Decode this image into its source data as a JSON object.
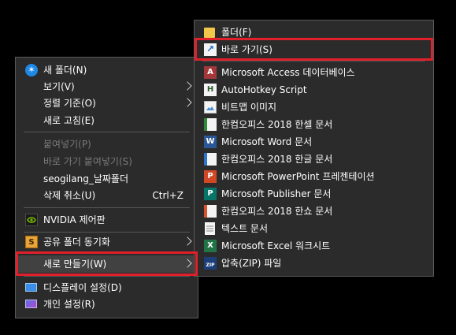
{
  "context_menu": {
    "items": [
      {
        "label": "새 폴더(N)"
      },
      {
        "label": "보기(V)"
      },
      {
        "label": "정렬 기준(O)"
      },
      {
        "label": "새로 고침(E)"
      },
      {
        "label": "붙여넣기(P)"
      },
      {
        "label": "바로 가기 붙여넣기(S)"
      },
      {
        "label": "seogilang_날짜폴더"
      },
      {
        "label": "삭제 취소(U)",
        "shortcut": "Ctrl+Z"
      },
      {
        "label": "NVIDIA 제어판"
      },
      {
        "label": "공유 폴더 동기화"
      },
      {
        "label": "새로 만들기(W)"
      },
      {
        "label": "디스플레이 설정(D)"
      },
      {
        "label": "개인 설정(R)"
      }
    ]
  },
  "new_submenu": {
    "items": [
      {
        "label": "폴더(F)"
      },
      {
        "label": "바로 가기(S)"
      },
      {
        "label": "Microsoft Access 데이터베이스"
      },
      {
        "label": "AutoHotkey Script"
      },
      {
        "label": "비트맵 이미지"
      },
      {
        "label": "한컴오피스 2018 한셀 문서"
      },
      {
        "label": "Microsoft Word 문서"
      },
      {
        "label": "한컴오피스 2018 한글 문서"
      },
      {
        "label": "Microsoft PowerPoint 프레젠테이션"
      },
      {
        "label": "Microsoft Publisher 문서"
      },
      {
        "label": "한컴오피스 2018 한쇼 문서"
      },
      {
        "label": "텍스트 문서"
      },
      {
        "label": "Microsoft Excel 워크시트"
      },
      {
        "label": "압축(ZIP) 파일"
      }
    ]
  },
  "icons": {
    "access_letter": "A",
    "ahk_letter": "H",
    "word_letter": "W",
    "ppt_letter": "P",
    "publisher_letter": "P",
    "excel_letter": "X",
    "sync_letter": "S",
    "zip_letter": "ZIP"
  },
  "colors": {
    "menu_bg": "#2b2b2b",
    "highlight_bg": "#414141",
    "annotation_red": "#e0202a",
    "disabled_text": "#7a7a7a"
  }
}
